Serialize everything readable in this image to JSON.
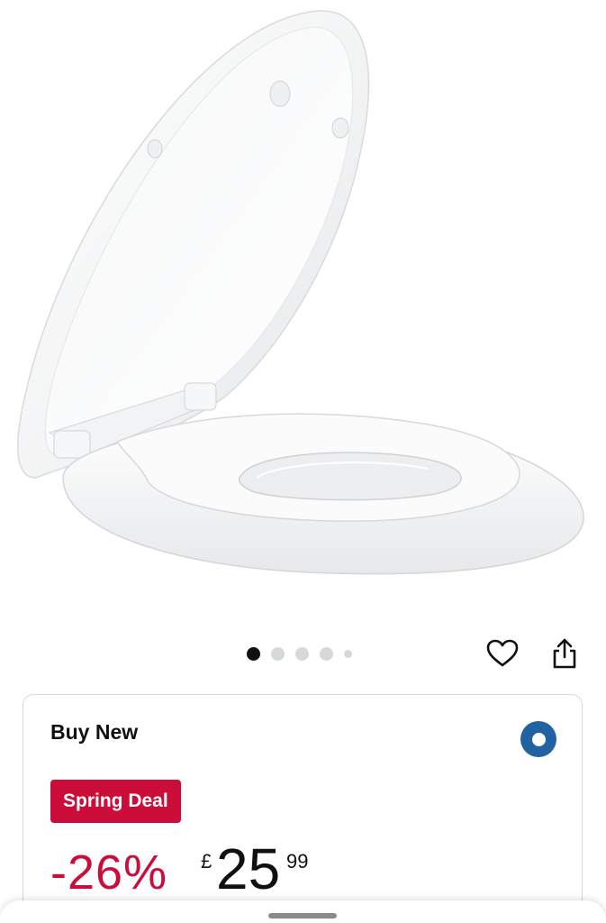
{
  "product": {
    "image_alt": "White toilet seat with built-in child seat, lid open",
    "gallery": {
      "total_dots": 5,
      "active_index": 0
    }
  },
  "actions": {
    "wishlist_icon": "heart-icon",
    "share_icon": "share-icon"
  },
  "offer": {
    "title": "Buy New",
    "selected": true,
    "deal_badge": "Spring Deal",
    "discount": "-26%",
    "currency_symbol": "£",
    "price_whole": "25",
    "price_fraction": "99"
  },
  "colors": {
    "deal_red": "#cc0c39",
    "radio_blue": "#2162a1",
    "text": "#0f1111",
    "border": "#d5d9d9"
  }
}
